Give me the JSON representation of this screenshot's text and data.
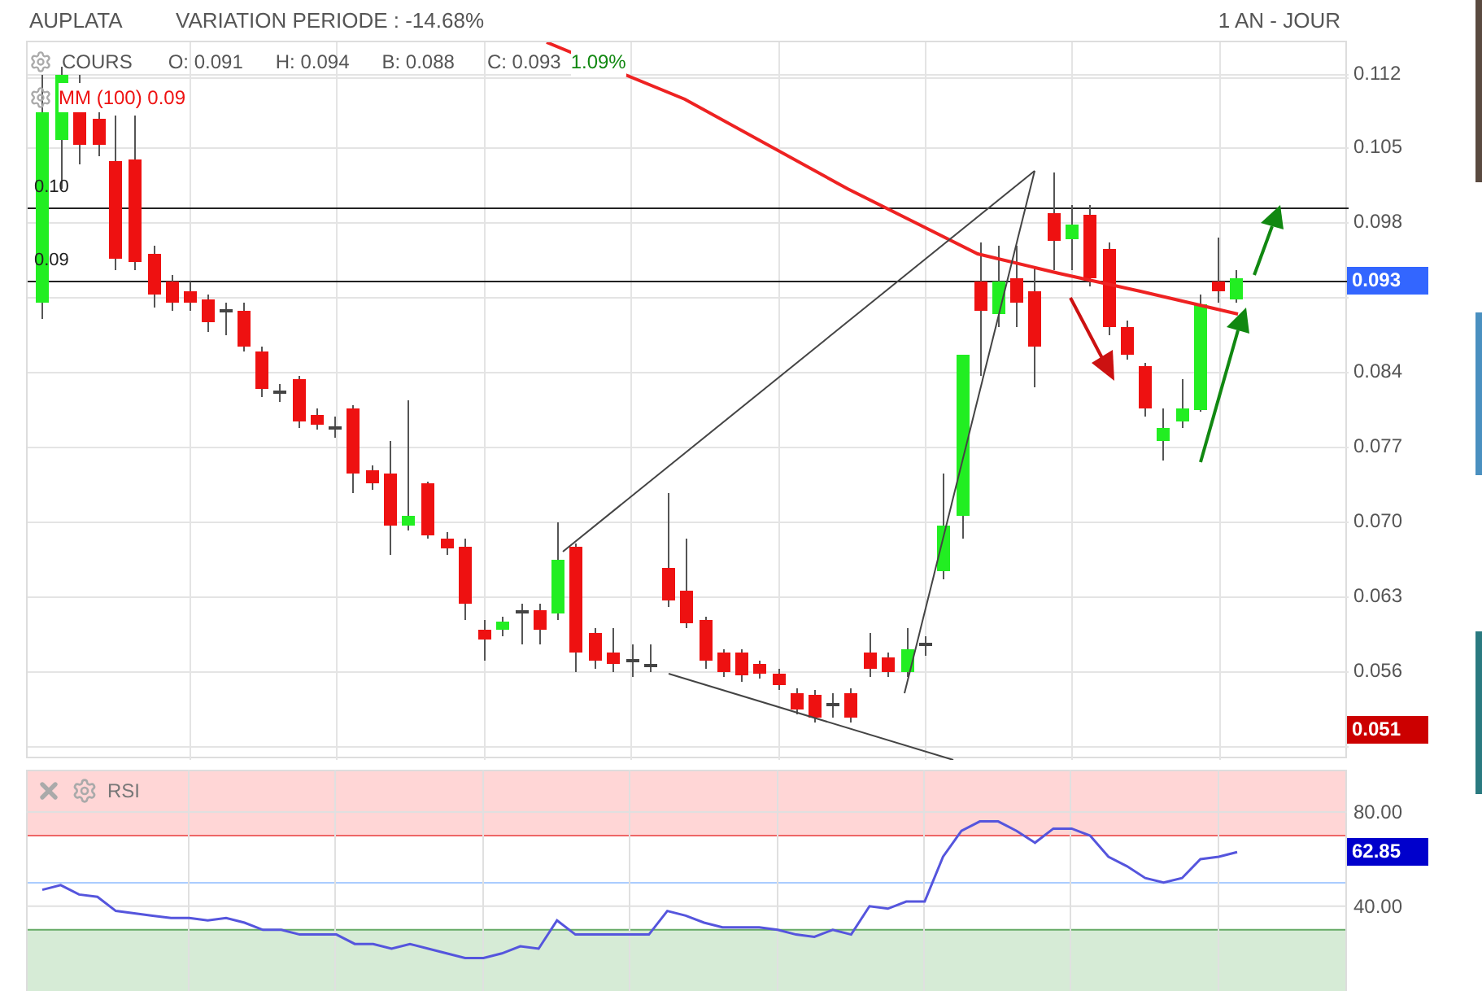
{
  "header": {
    "symbol": "AUPLATA",
    "variation": "VARIATION PERIODE : -14.68%",
    "period": "1 AN - JOUR"
  },
  "price_panel": {
    "legend": {
      "series": "COURS",
      "open": "O: 0.091",
      "high": "H: 0.094",
      "low": "B: 0.088",
      "close": "C: 0.093",
      "change": "1.09%"
    },
    "moving_average": "MM (100) 0.09",
    "lines": [
      {
        "label": "0.10"
      },
      {
        "label": "0.09"
      }
    ],
    "axis_labels": [
      "0.112",
      "0.105",
      "0.098",
      "0.084",
      "0.077",
      "0.070",
      "0.063",
      "0.056"
    ],
    "badges": [
      {
        "label": "0.093",
        "color": "#3366ff"
      },
      {
        "label": "0.051",
        "color": "#cc0000"
      }
    ]
  },
  "rsi_panel": {
    "chart_data": {
      "type": "line",
      "ylim": [
        4,
        98
      ],
      "grid": true,
      "yticks": [
        {
          "value": 80,
          "label": "80.00"
        },
        {
          "value": 40,
          "label": "40.00"
        }
      ],
      "series": [
        {
          "name": "RSI",
          "color": "#5555dd",
          "values": [
            47,
            49,
            45,
            44,
            38,
            37,
            36,
            35,
            35,
            34,
            35,
            33,
            30,
            30,
            28,
            28,
            28,
            24,
            24,
            22,
            24,
            22,
            20,
            18,
            18,
            20,
            23,
            22,
            34,
            28,
            28,
            28,
            28,
            28,
            38,
            36,
            33,
            31,
            31,
            31,
            30,
            28,
            27,
            30,
            28,
            40,
            39,
            42,
            42,
            61,
            72,
            76,
            76,
            72,
            67,
            73,
            73,
            70,
            61,
            57,
            52,
            50,
            52,
            60,
            61,
            63
          ]
        }
      ]
    },
    "badge": {
      "label": "62.85",
      "color": "#0000cc"
    }
  }
}
